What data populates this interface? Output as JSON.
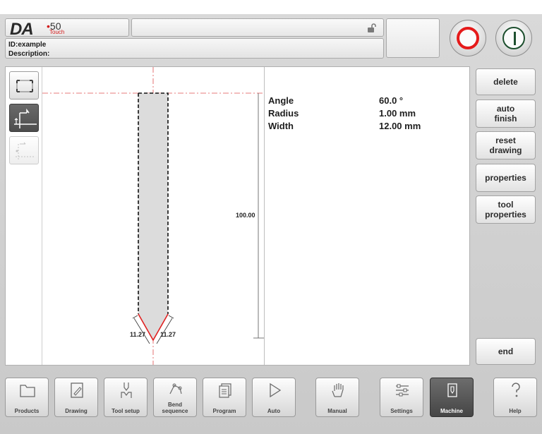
{
  "header": {
    "logo_text": "DA",
    "model_number": "50",
    "model_suffix": "Touch",
    "title_text": "",
    "id_line": "ID:example",
    "description_line": "Description:"
  },
  "controls": {
    "stop_icon": "stop-circle-icon",
    "start_icon": "start-bar-icon"
  },
  "drawing": {
    "height_dimension": "100.00",
    "left_angle_dimension": "11.27",
    "right_angle_dimension": "11.27"
  },
  "tool_properties": [
    {
      "label": "Angle",
      "value": "60.0 °"
    },
    {
      "label": "Radius",
      "value": "1.00 mm"
    },
    {
      "label": "Width",
      "value": "12.00 mm"
    }
  ],
  "side_buttons": {
    "delete": "delete",
    "auto_finish_1": "auto",
    "auto_finish_2": "finish",
    "reset_drawing_1": "reset",
    "reset_drawing_2": "drawing",
    "properties": "properties",
    "tool_properties_1": "tool",
    "tool_properties_2": "properties",
    "end": "end"
  },
  "nav": {
    "products": "Products",
    "drawing": "Drawing",
    "tool_setup": "Tool setup",
    "bend_sequence_1": "Bend",
    "bend_sequence_2": "sequence",
    "program": "Program",
    "auto": "Auto",
    "manual": "Manual",
    "settings": "Settings",
    "machine": "Machine",
    "help": "Help"
  },
  "colors": {
    "accent_red": "#e51a1a",
    "start_green": "#1d4f2e",
    "active_button": "#4d4d4d"
  }
}
